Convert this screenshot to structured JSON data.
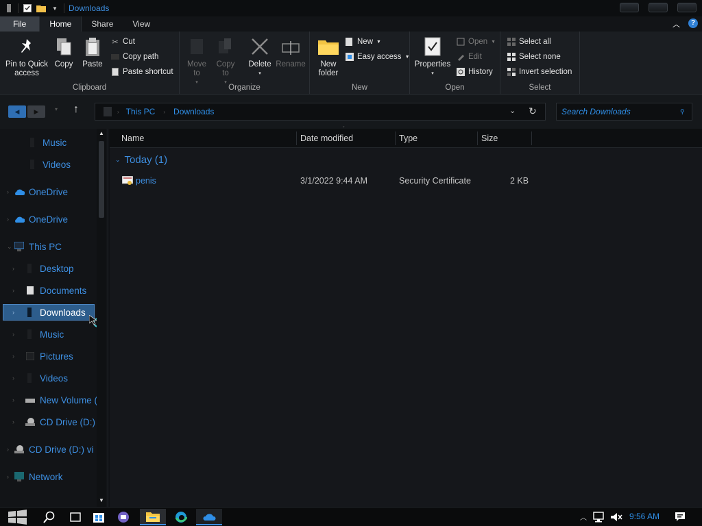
{
  "window": {
    "title": "Downloads"
  },
  "ribbon": {
    "tabs": [
      "File",
      "Home",
      "Share",
      "View"
    ],
    "groups": {
      "clipboard": {
        "label": "Clipboard",
        "pin": "Pin to Quick access",
        "copy": "Copy",
        "paste": "Paste",
        "cut": "Cut",
        "copy_path": "Copy path",
        "paste_shortcut": "Paste shortcut"
      },
      "organize": {
        "label": "Organize",
        "move_to": "Move to",
        "copy_to": "Copy to",
        "delete": "Delete",
        "rename": "Rename"
      },
      "new": {
        "label": "New",
        "new_folder": "New folder",
        "new_item": "New",
        "easy_access": "Easy access"
      },
      "open": {
        "label": "Open",
        "properties": "Properties",
        "open": "Open",
        "edit": "Edit",
        "history": "History"
      },
      "select": {
        "label": "Select",
        "select_all": "Select all",
        "select_none": "Select none",
        "invert": "Invert selection"
      }
    }
  },
  "address": {
    "crumbs": [
      "This PC",
      "Downloads"
    ],
    "search_placeholder": "Search Downloads"
  },
  "navpane": {
    "items": [
      {
        "label": "Music",
        "icon": "music-icon"
      },
      {
        "label": "Videos",
        "icon": "videos-icon"
      },
      {
        "label": "OneDrive",
        "icon": "onedrive-icon"
      },
      {
        "label": "OneDrive",
        "icon": "onedrive-icon"
      },
      {
        "label": "This PC",
        "icon": "this-pc-icon"
      },
      {
        "label": "Desktop",
        "icon": "desktop-icon"
      },
      {
        "label": "Documents",
        "icon": "documents-icon"
      },
      {
        "label": "Downloads",
        "icon": "downloads-icon",
        "selected": true
      },
      {
        "label": "Music",
        "icon": "music-icon"
      },
      {
        "label": "Pictures",
        "icon": "pictures-icon"
      },
      {
        "label": "Videos",
        "icon": "videos-icon"
      },
      {
        "label": "New Volume (",
        "icon": "drive-icon"
      },
      {
        "label": "CD Drive (D:) ",
        "icon": "cd-drive-icon"
      },
      {
        "label": "CD Drive (D:) vi",
        "icon": "cd-drive-icon"
      },
      {
        "label": "Network",
        "icon": "network-icon"
      }
    ]
  },
  "filelist": {
    "columns": [
      "Name",
      "Date modified",
      "Type",
      "Size"
    ],
    "group_header": "Today (1)",
    "rows": [
      {
        "name": "penis",
        "date": "3/1/2022 9:44 AM",
        "type": "Security Certificate",
        "size": "2 KB"
      }
    ]
  },
  "taskbar": {
    "time": "9:56 AM"
  },
  "colors": {
    "accent": "#3d8ee0",
    "selection": "#2d5d8c",
    "background": "#15171b"
  }
}
